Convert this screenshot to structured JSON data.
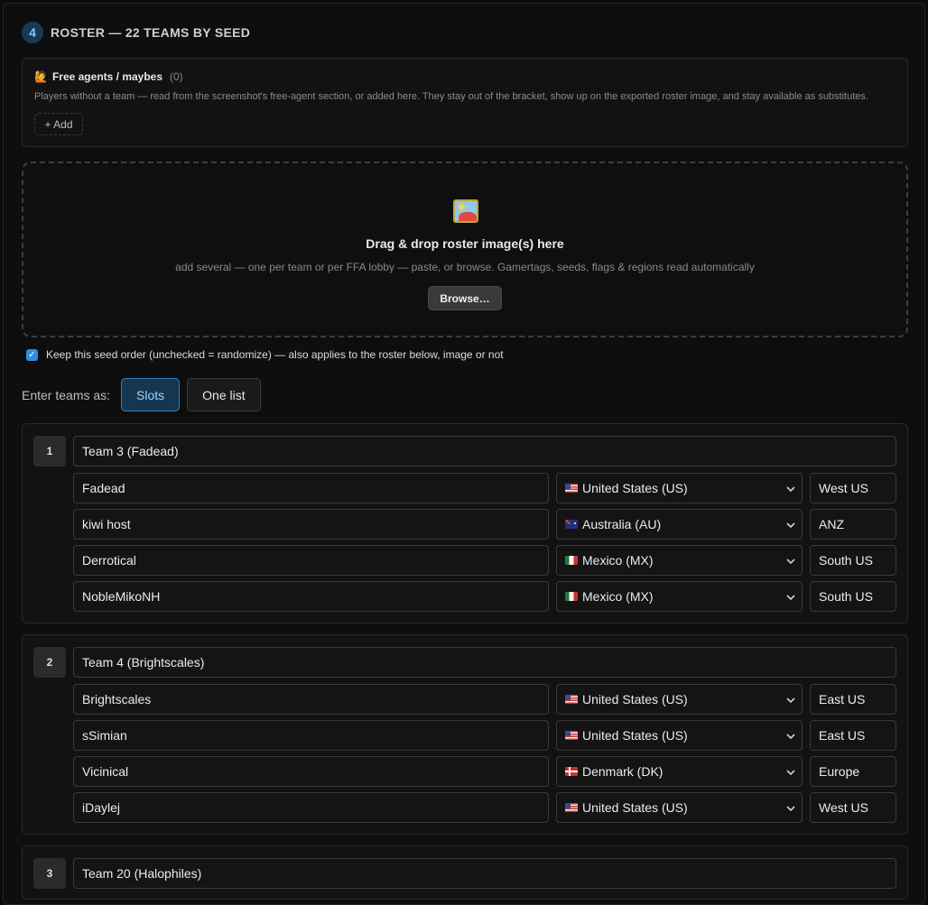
{
  "section": {
    "step": "4",
    "title": "ROSTER — 22 TEAMS BY SEED"
  },
  "free_agents": {
    "emoji": "🙋",
    "title": "Free agents / maybes",
    "count": "(0)",
    "description": "Players without a team — read from the screenshot's free-agent section, or added here. They stay out of the bracket, show up on the exported roster image, and stay available as substitutes.",
    "add_label": "+ Add"
  },
  "dropzone": {
    "icon": "framed-picture-icon",
    "title": "Drag & drop roster image(s) here",
    "subtitle": "add several — one per team or per FFA lobby — paste, or browse. Gamertags, seeds, flags & regions read automatically",
    "browse_label": "Browse…"
  },
  "keep_order": {
    "checked": true,
    "label": "Keep this seed order (unchecked = randomize) — also applies to the roster below, image or not"
  },
  "entry_mode": {
    "label": "Enter teams as:",
    "options": [
      "Slots",
      "One list"
    ],
    "selected": "Slots"
  },
  "colors": {
    "accent": "#2e8ee0",
    "active_bg": "#163650",
    "background": "#0b0b0b"
  },
  "teams": [
    {
      "seed": "1",
      "name": "Team 3 (Fadead)",
      "players": [
        {
          "tag": "Fadead",
          "country_code": "US",
          "country": "United States (US)",
          "region": "West US"
        },
        {
          "tag": "kiwi host",
          "country_code": "AU",
          "country": "Australia (AU)",
          "region": "ANZ"
        },
        {
          "tag": "Derrotical",
          "country_code": "MX",
          "country": "Mexico (MX)",
          "region": "South US"
        },
        {
          "tag": "NobleMikoNH",
          "country_code": "MX",
          "country": "Mexico (MX)",
          "region": "South US"
        }
      ]
    },
    {
      "seed": "2",
      "name": "Team 4 (Brightscales)",
      "players": [
        {
          "tag": "Brightscales",
          "country_code": "US",
          "country": "United States (US)",
          "region": "East US"
        },
        {
          "tag": "sSimian",
          "country_code": "US",
          "country": "United States (US)",
          "region": "East US"
        },
        {
          "tag": "Vicinical",
          "country_code": "DK",
          "country": "Denmark (DK)",
          "region": "Europe"
        },
        {
          "tag": "iDaylej",
          "country_code": "US",
          "country": "United States (US)",
          "region": "West US"
        }
      ]
    },
    {
      "seed": "3",
      "name": "Team 20 (Halophiles)",
      "players": []
    }
  ]
}
